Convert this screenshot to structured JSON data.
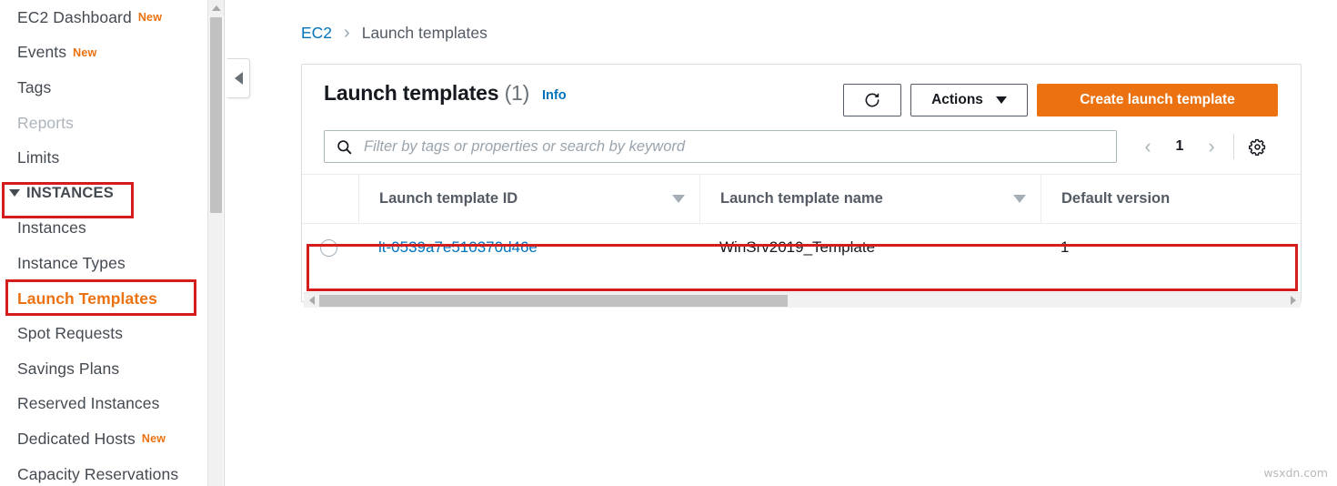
{
  "sidebar": {
    "items": [
      {
        "label": "EC2 Dashboard",
        "badge": "New",
        "state": "normal",
        "name": "sidebar-item-ec2-dashboard"
      },
      {
        "label": "Events",
        "badge": "New",
        "state": "normal",
        "name": "sidebar-item-events"
      },
      {
        "label": "Tags",
        "badge": "",
        "state": "normal",
        "name": "sidebar-item-tags"
      },
      {
        "label": "Reports",
        "badge": "",
        "state": "disabled",
        "name": "sidebar-item-reports"
      },
      {
        "label": "Limits",
        "badge": "",
        "state": "normal",
        "name": "sidebar-item-limits"
      }
    ],
    "group": {
      "label": "INSTANCES",
      "expanded": true,
      "name": "sidebar-group-instances"
    },
    "group_items": [
      {
        "label": "Instances",
        "badge": "",
        "state": "normal",
        "name": "sidebar-item-instances"
      },
      {
        "label": "Instance Types",
        "badge": "",
        "state": "normal",
        "name": "sidebar-item-instance-types"
      },
      {
        "label": "Launch Templates",
        "badge": "",
        "state": "selected",
        "name": "sidebar-item-launch-templates"
      },
      {
        "label": "Spot Requests",
        "badge": "",
        "state": "normal",
        "name": "sidebar-item-spot-requests"
      },
      {
        "label": "Savings Plans",
        "badge": "",
        "state": "normal",
        "name": "sidebar-item-savings-plans"
      },
      {
        "label": "Reserved Instances",
        "badge": "",
        "state": "normal",
        "name": "sidebar-item-reserved-instances"
      },
      {
        "label": "Dedicated Hosts",
        "badge": "New",
        "state": "normal",
        "name": "sidebar-item-dedicated-hosts"
      },
      {
        "label": "Capacity Reservations",
        "badge": "",
        "state": "normal",
        "name": "sidebar-item-capacity-reservations"
      }
    ]
  },
  "breadcrumb": {
    "root": "EC2",
    "separator": "›",
    "current": "Launch templates"
  },
  "panel": {
    "title": "Launch templates",
    "count": "(1)",
    "info_label": "Info",
    "refresh_icon": "refresh-icon",
    "actions_label": "Actions",
    "create_label": "Create launch template"
  },
  "filter": {
    "placeholder": "Filter by tags or properties or search by keyword",
    "value": "",
    "search_icon": "search-icon"
  },
  "pagination": {
    "prev": "‹",
    "page": "1",
    "next": "›",
    "settings_icon": "gear-icon"
  },
  "table": {
    "columns": [
      {
        "label": "Launch template ID",
        "sortable": true
      },
      {
        "label": "Launch template name",
        "sortable": true
      },
      {
        "label": "Default version",
        "sortable": false
      }
    ],
    "rows": [
      {
        "selected": false,
        "launch_template_id": "lt-0539a7e510370d46e",
        "launch_template_name": "WinSrv2019_Template",
        "default_version": "1"
      }
    ]
  },
  "watermark": "wsxdn.com",
  "colors": {
    "accent_orange": "#ec7211",
    "link_blue": "#0073bb",
    "highlight_red": "#d41d1d",
    "text_dark": "#16191f",
    "text_muted": "#545b64"
  }
}
